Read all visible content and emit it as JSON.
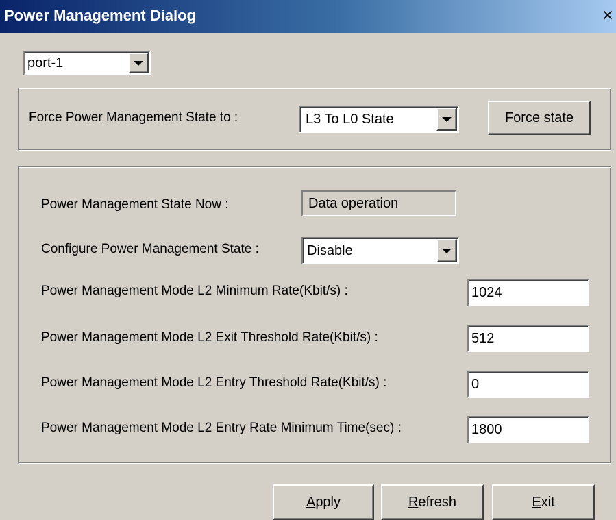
{
  "window": {
    "title": "Power Management Dialog",
    "close_glyph": "×"
  },
  "port_select": {
    "value": "port-1"
  },
  "force_group": {
    "label": "Force Power Management State to :",
    "state_select": "L3 To L0 State",
    "force_button": "Force state"
  },
  "settings": {
    "state_now_label": "Power Management State Now :",
    "state_now_value": "Data operation",
    "configure_label": "Configure Power Management State :",
    "configure_value": "Disable",
    "min_rate_label": "Power Management Mode L2 Minimum Rate(Kbit/s) :",
    "min_rate_value": "1024",
    "exit_threshold_label": "Power Management Mode L2 Exit Threshold Rate(Kbit/s) :",
    "exit_threshold_value": "512",
    "entry_threshold_label": "Power Management Mode L2 Entry Threshold Rate(Kbit/s) :",
    "entry_threshold_value": "0",
    "entry_min_time_label": "Power Management Mode L2 Entry Rate Minimum Time(sec) :",
    "entry_min_time_value": "1800"
  },
  "buttons": {
    "apply_accel": "A",
    "apply_rest": "pply",
    "refresh_accel": "R",
    "refresh_rest": "efresh",
    "exit_accel": "E",
    "exit_rest": "xit"
  },
  "colors": {
    "face": "#d4d0c8",
    "title_start": "#0a246a",
    "title_end": "#a6caf0"
  }
}
